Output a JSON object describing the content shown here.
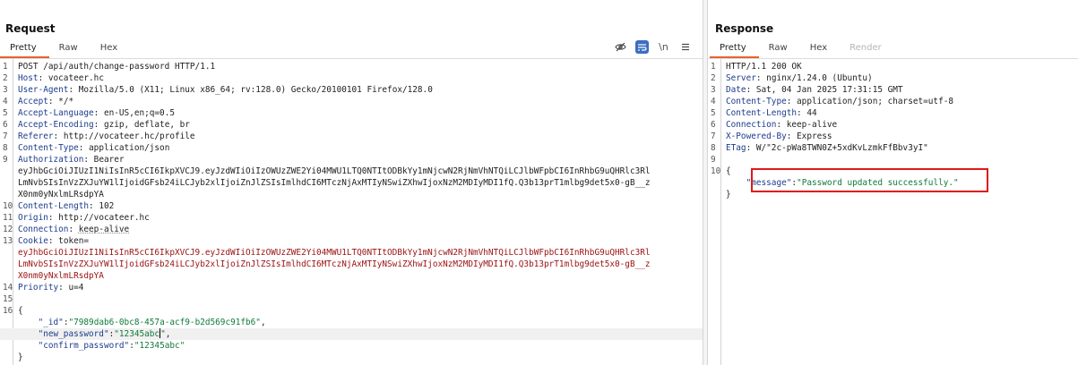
{
  "request": {
    "title": "Request",
    "tabs": [
      "Pretty",
      "Raw",
      "Hex"
    ],
    "tools": {
      "hide_icon": "eye-slash-icon",
      "wrap_icon": "wrap-lines-icon",
      "newline_label": "\\n",
      "menu_icon": "hamburger-menu-icon"
    },
    "lines": [
      {
        "n": "1",
        "text": "POST /api/auth/change-password HTTP/1.1"
      },
      {
        "n": "2",
        "name": "Host",
        "value": "vocateer.hc"
      },
      {
        "n": "3",
        "name": "User-Agent",
        "value": "Mozilla/5.0 (X11; Linux x86_64; rv:128.0) Gecko/20100101 Firefox/128.0"
      },
      {
        "n": "4",
        "name": "Accept",
        "value": "*/*"
      },
      {
        "n": "5",
        "name": "Accept-Language",
        "value": "en-US,en;q=0.5"
      },
      {
        "n": "6",
        "name": "Accept-Encoding",
        "value": "gzip, deflate, br"
      },
      {
        "n": "7",
        "name": "Referer",
        "value": "http://vocateer.hc/profile"
      },
      {
        "n": "8",
        "name": "Content-Type",
        "value": "application/json"
      },
      {
        "n": "9",
        "name": "Authorization",
        "value": "Bearer"
      },
      {
        "n": "",
        "text": "eyJhbGciOiJIUzI1NiIsInR5cCI6IkpXVCJ9.eyJzdWIiOiIzOWUzZWE2Yi04MWU1LTQ0NTItODBkYy1mNjcwN2RjNmVhNTQiLCJlbWFpbCI6InRhbG9uQHRlc3Rl"
      },
      {
        "n": "",
        "text": "LmNvbSIsInVzZXJuYW1lIjoidGFsb24iLCJyb2xlIjoiZnJlZSIsImlhdCI6MTczNjAxMTIyNSwiZXhwIjoxNzM2MDIyMDI1fQ.Q3b13prT1mlbg9det5x0-gB__z"
      },
      {
        "n": "",
        "text": "X0nm0yNxlmLRsdpYA"
      },
      {
        "n": "10",
        "name": "Content-Length",
        "value": "102"
      },
      {
        "n": "11",
        "name": "Origin",
        "value": "http://vocateer.hc"
      },
      {
        "n": "12",
        "name": "Connection",
        "value": "keep-alive"
      },
      {
        "n": "13",
        "name": "Cookie",
        "value": "token="
      },
      {
        "n": "",
        "token": "eyJhbGciOiJIUzI1NiIsInR5cCI6IkpXVCJ9.eyJzdWIiOiIzOWUzZWE2Yi04MWU1LTQ0NTItODBkYy1mNjcwN2RjNmVhNTQiLCJlbWFpbCI6InRhbG9uQHRlc3Rl"
      },
      {
        "n": "",
        "token": "LmNvbSIsInVzZXJuYW1lIjoidGFsb24iLCJyb2xlIjoiZnJlZSIsImlhdCI6MTczNjAxMTIyNSwiZXhwIjoxNzM2MDIyMDI1fQ.Q3b13prT1mlbg9det5x0-gB__z"
      },
      {
        "n": "",
        "token": "X0nm0yNxlmLRsdpYA"
      },
      {
        "n": "14",
        "name": "Priority",
        "value": "u=4"
      },
      {
        "n": "15",
        "text": ""
      },
      {
        "n": "16",
        "text": "{"
      },
      {
        "n": "",
        "indent": "    ",
        "key": "\"_id\"",
        "str": "\"7989dab6-0bc8-457a-acf9-b2d569c91fb6\"",
        "tail": ","
      },
      {
        "n": "",
        "indent": "    ",
        "key": "\"new_password\"",
        "str": "\"12345abc\"",
        "tail": ",",
        "caret": true
      },
      {
        "n": "",
        "indent": "    ",
        "key": "\"confirm_password\"",
        "str": "\"12345abc\"",
        "tail": ""
      },
      {
        "n": "",
        "text": "}"
      }
    ]
  },
  "response": {
    "title": "Response",
    "tabs": [
      "Pretty",
      "Raw",
      "Hex",
      "Render"
    ],
    "lines": [
      {
        "n": "1",
        "text": "HTTP/1.1 200 OK"
      },
      {
        "n": "2",
        "name": "Server",
        "value": "nginx/1.24.0 (Ubuntu)"
      },
      {
        "n": "3",
        "name": "Date",
        "value": "Sat, 04 Jan 2025 17:31:15 GMT"
      },
      {
        "n": "4",
        "name": "Content-Type",
        "value": "application/json; charset=utf-8"
      },
      {
        "n": "5",
        "name": "Content-Length",
        "value": "44"
      },
      {
        "n": "6",
        "name": "Connection",
        "value": "keep-alive"
      },
      {
        "n": "7",
        "name": "X-Powered-By",
        "value": "Express"
      },
      {
        "n": "8",
        "name": "ETag",
        "value": "W/\"2c-pWa8TWN0Z+5xdKvLzmkFfBbv3yI\""
      },
      {
        "n": "9",
        "text": ""
      },
      {
        "n": "10",
        "text": "{"
      },
      {
        "n": "",
        "indent": "    ",
        "key": "\"message\"",
        "str": "\"Password updated successfully.\"",
        "tail": ""
      },
      {
        "n": "",
        "text": "}"
      }
    ]
  },
  "colors": {
    "tab_accent": "#e8612c",
    "header_name": "#1c3c8c",
    "token": "#9b1010",
    "json_string": "#0f7a3a",
    "highlight_box": "#e01818"
  }
}
